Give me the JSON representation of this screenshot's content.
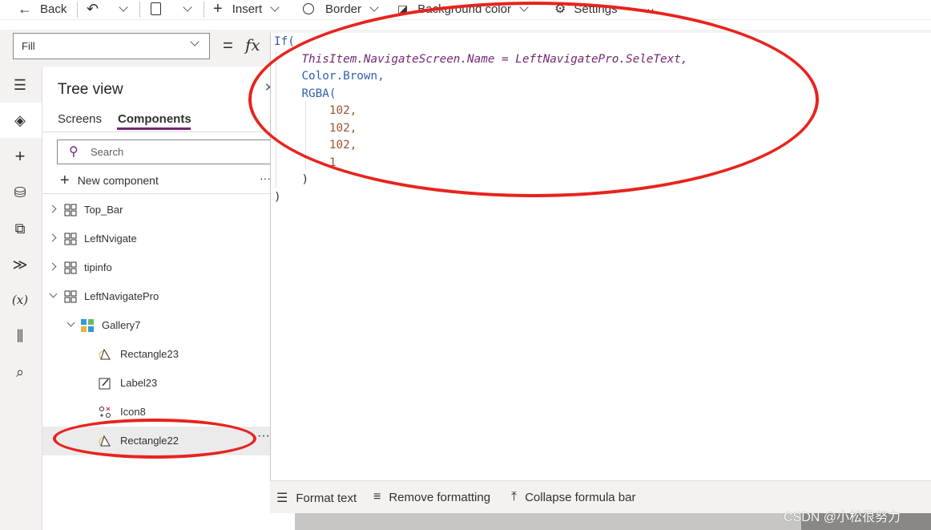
{
  "toolbar": {
    "back_label": "Back",
    "insert_label": "Insert",
    "border_label": "Border",
    "background_color_label": "Background color",
    "settings_label": "Settings",
    "more_label": "···"
  },
  "formula_bar": {
    "property": "Fill",
    "equals": "=",
    "fx": "fx",
    "code_lines": [
      "If(",
      "ThisItem.NavigateScreen.Name = LeftNavigatePro.SeleText,",
      "Color.Brown,",
      "RGBA(",
      "102,",
      "102,",
      "102,",
      "1",
      ")",
      ")"
    ]
  },
  "tree_view": {
    "title": "Tree view",
    "tabs": [
      "Screens",
      "Components"
    ],
    "active_tab": "Components",
    "search_placeholder": "Search",
    "new_component_label": "New component",
    "more": "···",
    "items": [
      {
        "label": "Top_Bar",
        "icon": "component-icon",
        "expanded": false
      },
      {
        "label": "LeftNvigate",
        "icon": "component-icon",
        "expanded": false
      },
      {
        "label": "tipinfo",
        "icon": "component-icon",
        "expanded": false
      },
      {
        "label": "LeftNavigatePro",
        "icon": "component-icon",
        "expanded": true
      },
      {
        "label": "Gallery7",
        "icon": "gallery-icon",
        "expanded": true
      },
      {
        "label": "Rectangle23",
        "icon": "shape-icon"
      },
      {
        "label": "Label23",
        "icon": "label-icon"
      },
      {
        "label": "Icon8",
        "icon": "icons-icon"
      },
      {
        "label": "Rectangle22",
        "icon": "shape-icon",
        "selected": true
      }
    ],
    "row_more": "···"
  },
  "bottom_bar": {
    "format_text": "Format text",
    "remove_formatting": "Remove formatting",
    "collapse_formula_bar": "Collapse formula bar"
  },
  "watermark": "CSDN @小松很努力",
  "colors": {
    "accent": "#742774",
    "annotation_red": "#e8231d"
  }
}
